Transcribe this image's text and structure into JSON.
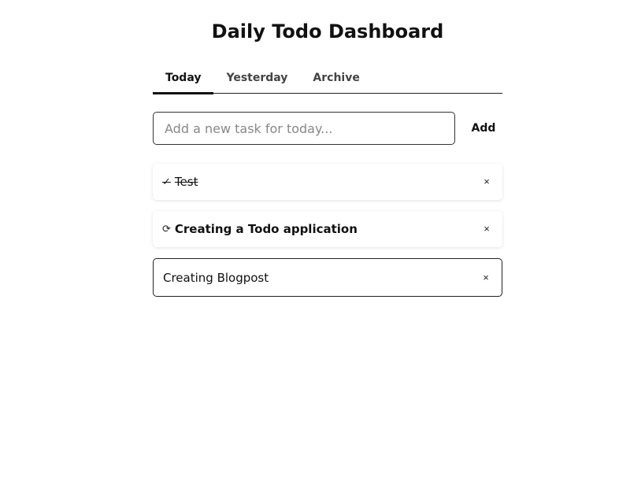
{
  "header": {
    "title": "Daily Todo Dashboard"
  },
  "tabs": [
    {
      "label": "Today",
      "active": true
    },
    {
      "label": "Yesterday",
      "active": false
    },
    {
      "label": "Archive",
      "active": false
    }
  ],
  "new_task": {
    "placeholder": "Add a new task for today...",
    "value": ""
  },
  "add_button": {
    "label": "Add"
  },
  "tasks": [
    {
      "status_icon": "✓",
      "label": "Test",
      "state": "done",
      "delete_icon": "×"
    },
    {
      "status_icon": "⟳",
      "label": "Creating a Todo application",
      "state": "in-progress",
      "delete_icon": "×"
    },
    {
      "status_icon": "",
      "label": "Creating Blogpost",
      "state": "editing",
      "delete_icon": "×"
    }
  ]
}
